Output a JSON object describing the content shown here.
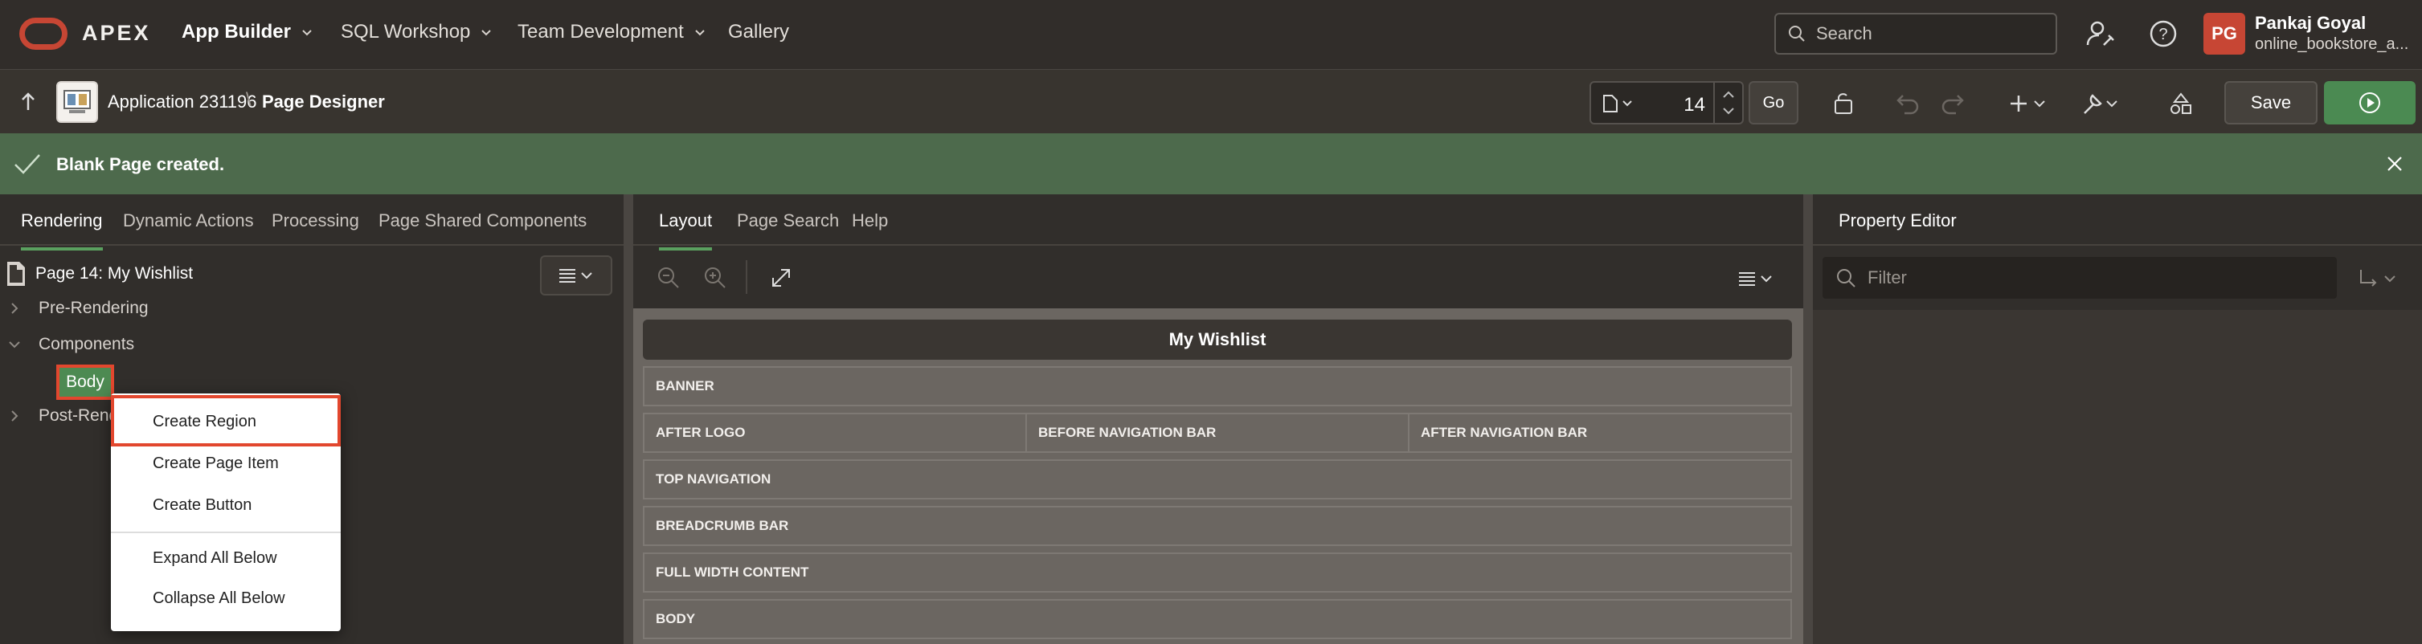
{
  "topnav": {
    "brand": "APEX",
    "items": [
      {
        "label": "App Builder"
      },
      {
        "label": "SQL Workshop"
      },
      {
        "label": "Team Development"
      },
      {
        "label": "Gallery"
      }
    ],
    "search_placeholder": "Search",
    "user": {
      "initials": "PG",
      "name": "Pankaj Goyal",
      "app": "online_bookstore_a..."
    }
  },
  "toolbar": {
    "app_name": "Application 231196",
    "separator": "\\",
    "page_designer": "Page Designer",
    "page_number": "14",
    "go_label": "Go",
    "save_label": "Save"
  },
  "banner": {
    "message": "Blank Page created."
  },
  "left": {
    "tabs": [
      "Rendering",
      "Dynamic Actions",
      "Processing",
      "Page Shared Components"
    ],
    "tree": {
      "page": "Page 14: My Wishlist",
      "pre_rendering": "Pre-Rendering",
      "components": "Components",
      "body": "Body",
      "post_rendering": "Post-Rend"
    },
    "context_menu": [
      "Create Region",
      "Create Page Item",
      "Create Button",
      "Expand All Below",
      "Collapse All Below"
    ]
  },
  "middle": {
    "tabs": [
      "Layout",
      "Page Search",
      "Help"
    ],
    "page_title": "My Wishlist",
    "slots": {
      "banner": "BANNER",
      "after_logo": "AFTER LOGO",
      "before_nav": "BEFORE NAVIGATION BAR",
      "after_nav": "AFTER NAVIGATION BAR",
      "top_nav": "TOP NAVIGATION",
      "breadcrumb": "BREADCRUMB BAR",
      "full_width": "FULL WIDTH CONTENT",
      "body": "BODY"
    }
  },
  "right": {
    "tab": "Property Editor",
    "filter_placeholder": "Filter"
  },
  "colors": {
    "accent_red": "#c74634",
    "success_green": "#4d6a4c",
    "run_green": "#4b8a52",
    "highlight": "#e2472e"
  }
}
